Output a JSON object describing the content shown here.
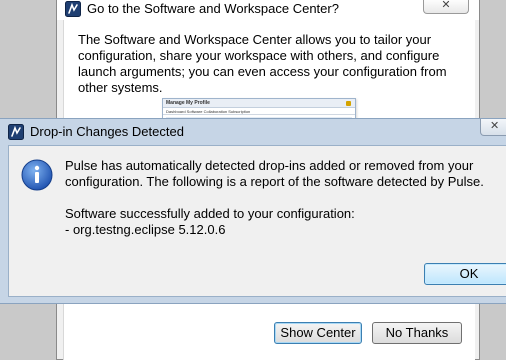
{
  "back_dialog": {
    "title": "Go to the Software and Workspace Center?",
    "close_label": "✕",
    "description": "The Software and Workspace Center allows you to tailor your configuration, share your workspace with others, and configure launch arguments; you can even access your configuration from other systems.",
    "thumbnail": {
      "heading": "Manage My Profile",
      "tabs": "Dashboard   Software   Collaboration   Subscription"
    },
    "show_center_label": "Show Center",
    "no_thanks_label": "No Thanks"
  },
  "front_dialog": {
    "title": "Drop-in Changes Detected",
    "close_label": "✕",
    "message": "Pulse has automatically detected drop-ins added or removed from your configuration.  The following is a report of the software detected by Pulse.",
    "report_heading": "Software successfully added to your configuration:",
    "report_item": "- org.testng.eclipse 5.12.0.6",
    "ok_label": "OK"
  },
  "icons": {
    "app": "pulse-app-icon",
    "info": "info-icon"
  },
  "colors": {
    "dialog_frame": "#c6d5e6",
    "accent_button": "#3c7fb1",
    "info_icon": "#2a64c5"
  }
}
